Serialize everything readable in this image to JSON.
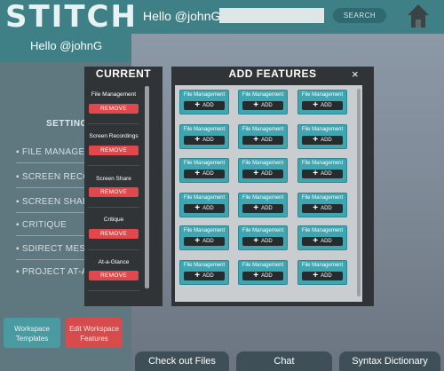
{
  "app": {
    "logo": "STITCH",
    "greeting": "Hello @johnG",
    "search_placeholder": "",
    "search_button": "SEARCH",
    "home_icon": "home-icon"
  },
  "sidebar": {
    "greeting": "Hello @johnG",
    "settings_label": "SETTINGS",
    "items": [
      {
        "label": "▪ FILE MANAGEMENT"
      },
      {
        "label": "▪ SCREEN RECORDINGS"
      },
      {
        "label": "▪ SCREEN SHARE"
      },
      {
        "label": "▪ CRITIQUE"
      },
      {
        "label": "▪ SDIRECT MESSAGES"
      },
      {
        "label": "▪ PROJECT AT-A-GLANCE"
      }
    ],
    "workspace_templates": "Workspace Templates",
    "edit_features": "Edit Workspace Features"
  },
  "bottom_tabs": [
    "Check out Files",
    "Chat",
    "Syntax Dictionary"
  ],
  "modal": {
    "current_title": "CURRENT",
    "add_title": "ADD FEATURES",
    "close_label": "×",
    "remove_label": "REMOVE",
    "current": [
      {
        "label": "File Management"
      },
      {
        "label": "Screen Recordings"
      },
      {
        "label": "Screen Share"
      },
      {
        "label": "Critique"
      },
      {
        "label": "At-a-Glance"
      }
    ],
    "add_label": "ADD",
    "cards": [
      "File Management",
      "File Management",
      "File Management",
      "File Management",
      "File Management",
      "File Management",
      "File Management",
      "File Management",
      "File Management",
      "File Management",
      "File Management",
      "File Management",
      "File Management",
      "File Management",
      "File Management",
      "File Management",
      "File Management",
      "File Management"
    ]
  }
}
